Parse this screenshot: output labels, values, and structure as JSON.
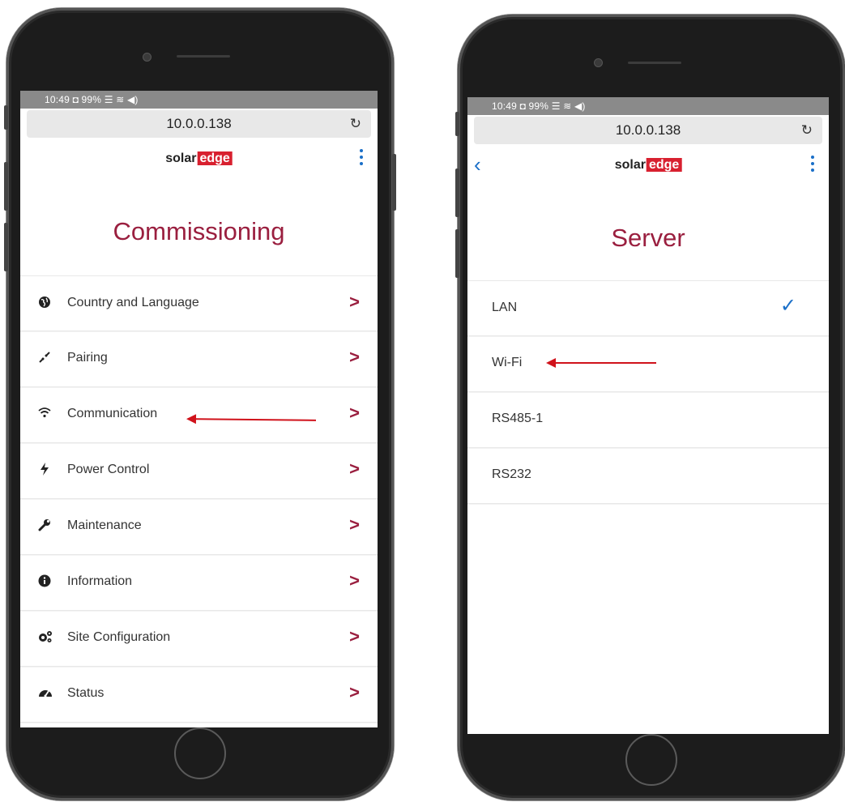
{
  "left_phone": {
    "status_bar": "10:49 ◘ 99% ☰ ≋ ◀)",
    "url": "10.0.0.138",
    "reload_icon": "reload-icon",
    "logo": {
      "text": "solar",
      "box": "edge"
    },
    "title": "Commissioning",
    "menu": [
      {
        "label": "Country and Language",
        "icon": "globe-icon"
      },
      {
        "label": "Pairing",
        "icon": "pairing-icon"
      },
      {
        "label": "Communication",
        "icon": "wifi-icon"
      },
      {
        "label": "Power Control",
        "icon": "bolt-icon"
      },
      {
        "label": "Maintenance",
        "icon": "wrench-icon"
      },
      {
        "label": "Information",
        "icon": "info-icon"
      },
      {
        "label": "Site Configuration",
        "icon": "gears-icon"
      },
      {
        "label": "Status",
        "icon": "gauge-icon"
      }
    ]
  },
  "right_phone": {
    "status_bar": "10:49 ◘ 99% ☰ ≋ ◀)",
    "url": "10.0.0.138",
    "logo": {
      "text": "solar",
      "box": "edge"
    },
    "title": "Server",
    "options": [
      {
        "label": "LAN",
        "selected": true
      },
      {
        "label": "Wi-Fi",
        "selected": false
      },
      {
        "label": "RS485-1",
        "selected": false
      },
      {
        "label": "RS232",
        "selected": false
      }
    ]
  },
  "colors": {
    "brand_red": "#d8202f",
    "title_maroon": "#9a1f3f",
    "link_blue": "#1a6fc8",
    "annotation_red": "#d0121b"
  }
}
